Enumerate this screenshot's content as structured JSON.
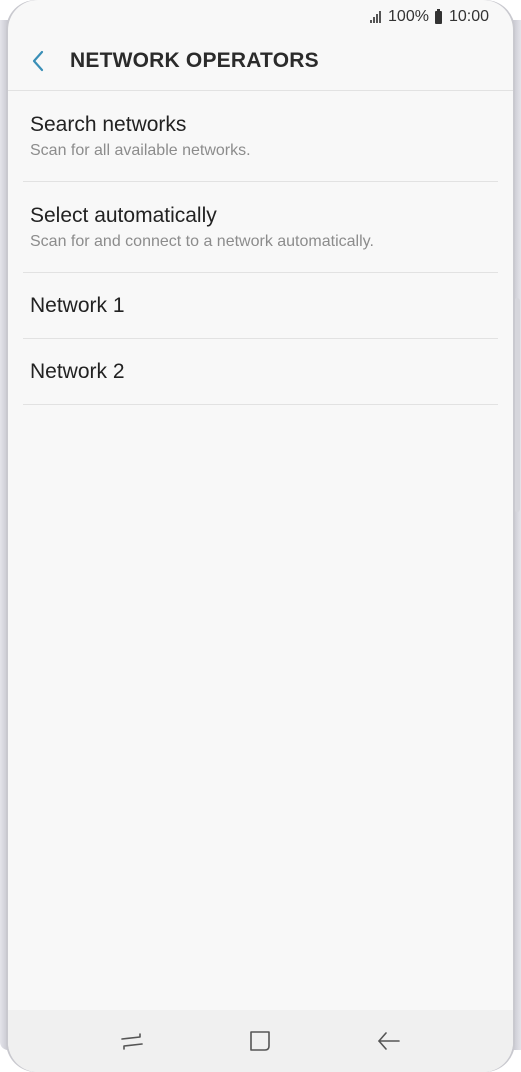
{
  "status_bar": {
    "battery": "100%",
    "time": "10:00"
  },
  "header": {
    "title": "NETWORK OPERATORS"
  },
  "list": {
    "items": [
      {
        "title": "Search networks",
        "subtitle": "Scan for all available networks."
      },
      {
        "title": "Select automatically",
        "subtitle": "Scan for and connect to a network automatically."
      },
      {
        "title": "Network 1"
      },
      {
        "title": "Network 2"
      }
    ]
  },
  "colors": {
    "accent": "#3a8fb7",
    "background": "#f8f8f8",
    "divider": "#e2e2e2"
  },
  "icons": {
    "back": "chevron-left-icon",
    "recents": "recents-icon",
    "home": "home-icon",
    "nav_back": "arrow-left-icon"
  }
}
